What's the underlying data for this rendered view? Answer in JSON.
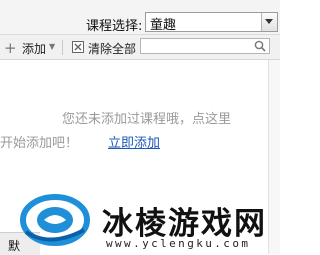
{
  "header": {
    "course_label": "课程选择:",
    "course_value": "童趣"
  },
  "toolbar": {
    "add_label": "添加",
    "clear_label": "清除全部",
    "search_placeholder": ""
  },
  "empty_state": {
    "line1": "您还未添加过课程哦，点这里",
    "line2": "开始添加吧！",
    "link": "立即添加"
  },
  "footer": {
    "tab_label": "默"
  },
  "watermark": {
    "title": "冰棱游戏网",
    "url": "www.yclengku.com"
  },
  "icons": {
    "dropdown": "chevron-down-icon",
    "add": "plus-icon",
    "add_caret": "caret-down-icon",
    "clear": "delete-icon",
    "search": "search-icon",
    "logo": "watermark-logo-icon"
  },
  "colors": {
    "link": "#1b58b8",
    "hint_text": "#9a9a9a",
    "logo_blue": "#1e8fd8"
  }
}
